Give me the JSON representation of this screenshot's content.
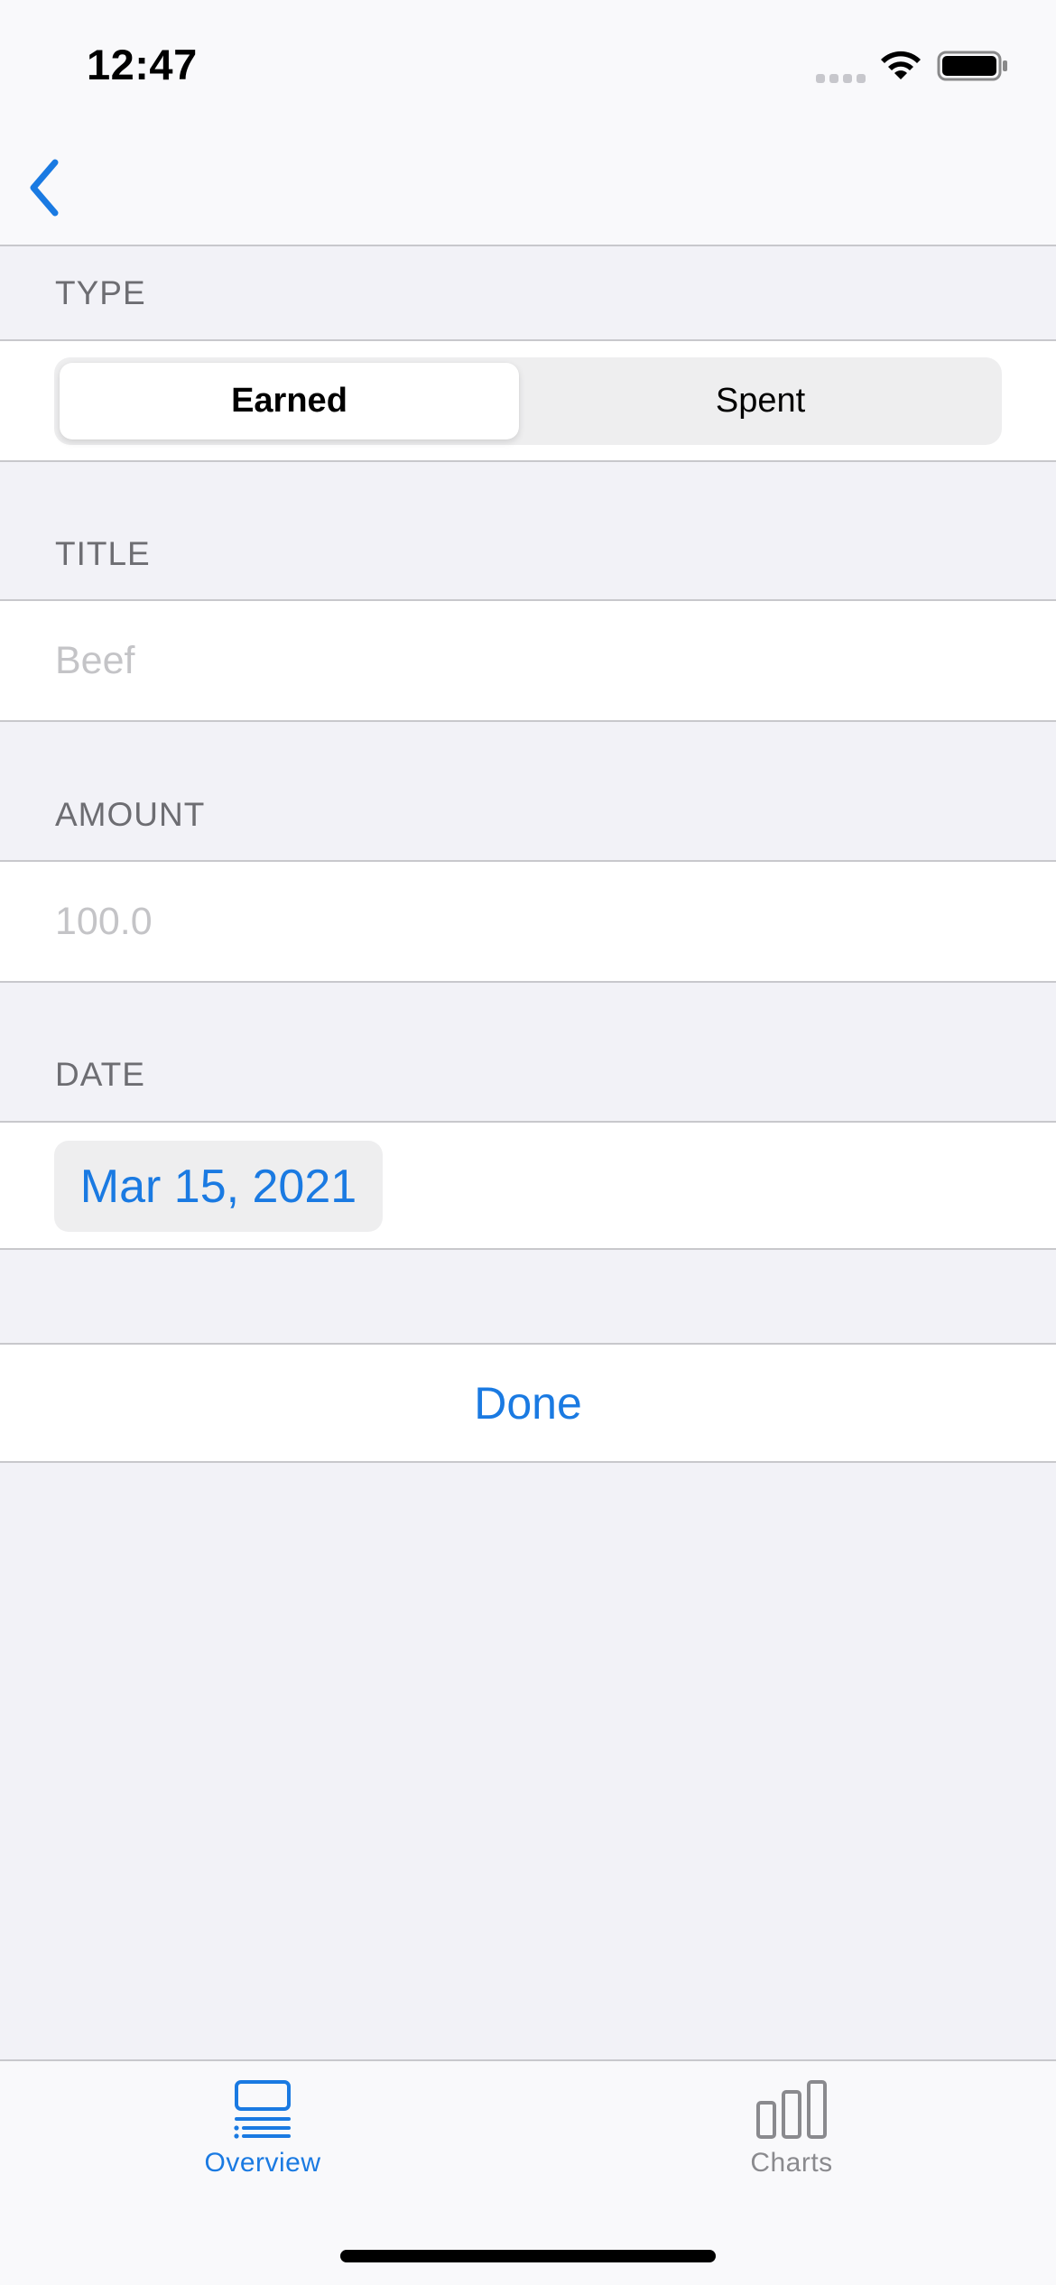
{
  "status_bar": {
    "time": "12:47"
  },
  "nav": {
    "back_icon": "chevron-left-icon"
  },
  "form": {
    "type": {
      "header": "TYPE",
      "options": [
        "Earned",
        "Spent"
      ],
      "selected": "Earned"
    },
    "title": {
      "header": "TITLE",
      "value": "",
      "placeholder": "Beef"
    },
    "amount": {
      "header": "AMOUNT",
      "value": "",
      "placeholder": "100.0"
    },
    "date": {
      "header": "DATE",
      "value": "Mar 15, 2021"
    },
    "done_label": "Done"
  },
  "tab_bar": {
    "items": [
      {
        "label": "Overview",
        "icon": "list-icon",
        "selected": true
      },
      {
        "label": "Charts",
        "icon": "bar-chart-icon",
        "selected": false
      }
    ]
  },
  "colors": {
    "accent": "#1a7ae2",
    "background": "#f2f2f7",
    "secondary_text": "#6d6d72",
    "placeholder": "#c4c4c7",
    "inactive_tab": "#8a8a8e"
  }
}
